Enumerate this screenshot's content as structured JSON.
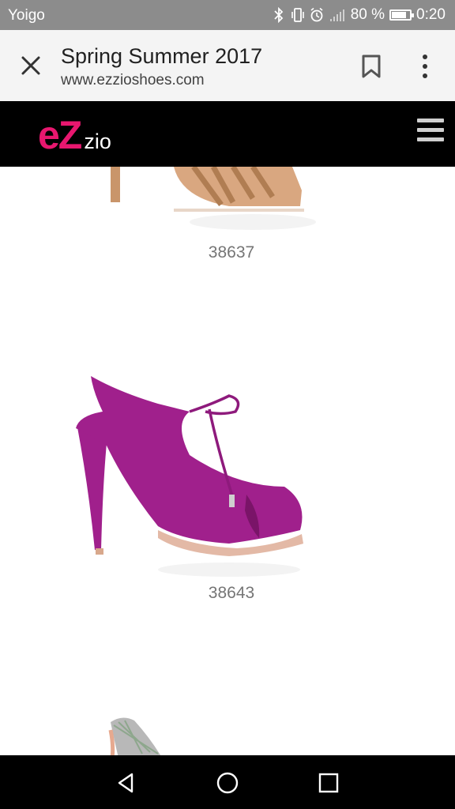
{
  "status_bar": {
    "carrier": "Yoigo",
    "battery_percent": "80 %",
    "battery_level": 0.8,
    "time": "0:20",
    "icons": [
      "bluetooth-icon",
      "vibrate-icon",
      "alarm-icon",
      "signal-icon",
      "battery-icon"
    ]
  },
  "browser": {
    "title": "Spring Summer 2017",
    "url": "www.ezzioshoes.com",
    "icons": [
      "close-icon",
      "bookmark-icon",
      "more-vert-icon"
    ]
  },
  "site": {
    "logo_ez": "eZ",
    "logo_zio": "zio",
    "brand_color": "#e8176f",
    "menu_icon": "hamburger-menu-icon"
  },
  "products": [
    {
      "code": "38637",
      "color": "#c9956a",
      "image": "tan strappy heeled sandal (cropped)"
    },
    {
      "code": "38643",
      "color": "#a0208c",
      "image": "magenta suede lace-up peep-toe platform sandal"
    },
    {
      "code": "",
      "color": "#b8b8b8",
      "image": "metallic snakeskin heel (partially visible)"
    }
  ],
  "nav_bar": {
    "icons": [
      "back-icon",
      "home-icon",
      "recents-icon"
    ]
  }
}
